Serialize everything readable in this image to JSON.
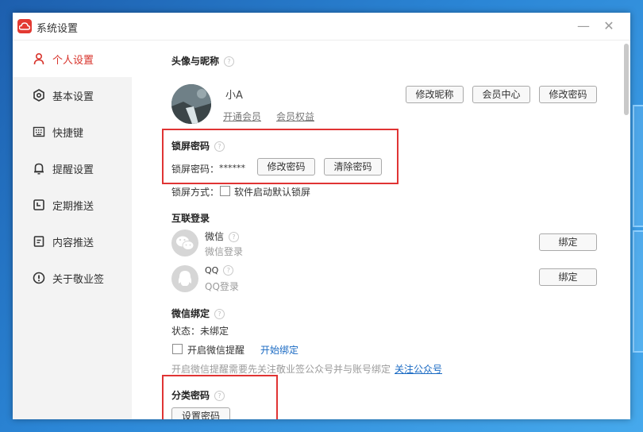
{
  "window": {
    "title": "系统设置",
    "minimize": "—",
    "close": "✕"
  },
  "sidebar": {
    "items": [
      {
        "label": "个人设置",
        "icon": "user-icon",
        "active": true
      },
      {
        "label": "基本设置",
        "icon": "gear-icon"
      },
      {
        "label": "快捷键",
        "icon": "keyboard-icon"
      },
      {
        "label": "提醒设置",
        "icon": "bell-icon"
      },
      {
        "label": "定期推送",
        "icon": "calendar-clock-icon"
      },
      {
        "label": "内容推送",
        "icon": "document-icon"
      },
      {
        "label": "关于敬业签",
        "icon": "info-icon"
      }
    ]
  },
  "profile": {
    "title": "头像与昵称",
    "nickname": "小A",
    "open_member": "开通会员",
    "member_rights": "会员权益",
    "buttons": {
      "edit_nickname": "修改昵称",
      "member_center": "会员中心",
      "change_password": "修改密码"
    }
  },
  "lock": {
    "title": "锁屏密码",
    "password_label": "锁屏密码：",
    "password_value": "******",
    "change_btn": "修改密码",
    "clear_btn": "清除密码",
    "mode_label": "锁屏方式：",
    "mode_option": "软件启动默认锁屏"
  },
  "connect": {
    "title": "互联登录",
    "wechat": {
      "name": "微信",
      "sub": "微信登录",
      "btn": "绑定"
    },
    "qq": {
      "name": "QQ",
      "sub": "QQ登录",
      "btn": "绑定"
    }
  },
  "wechat_bind": {
    "title": "微信绑定",
    "status": "状态：未绑定",
    "reminder": "开启微信提醒",
    "start": "开始绑定",
    "note": "开启微信提醒需要先关注敬业签公众号并与账号绑定",
    "follow": "关注公众号"
  },
  "category": {
    "title": "分类密码",
    "set_btn": "设置密码"
  },
  "colors": {
    "accent": "#d8342c",
    "link": "#1a6ac3",
    "highlight": "#e03434"
  }
}
